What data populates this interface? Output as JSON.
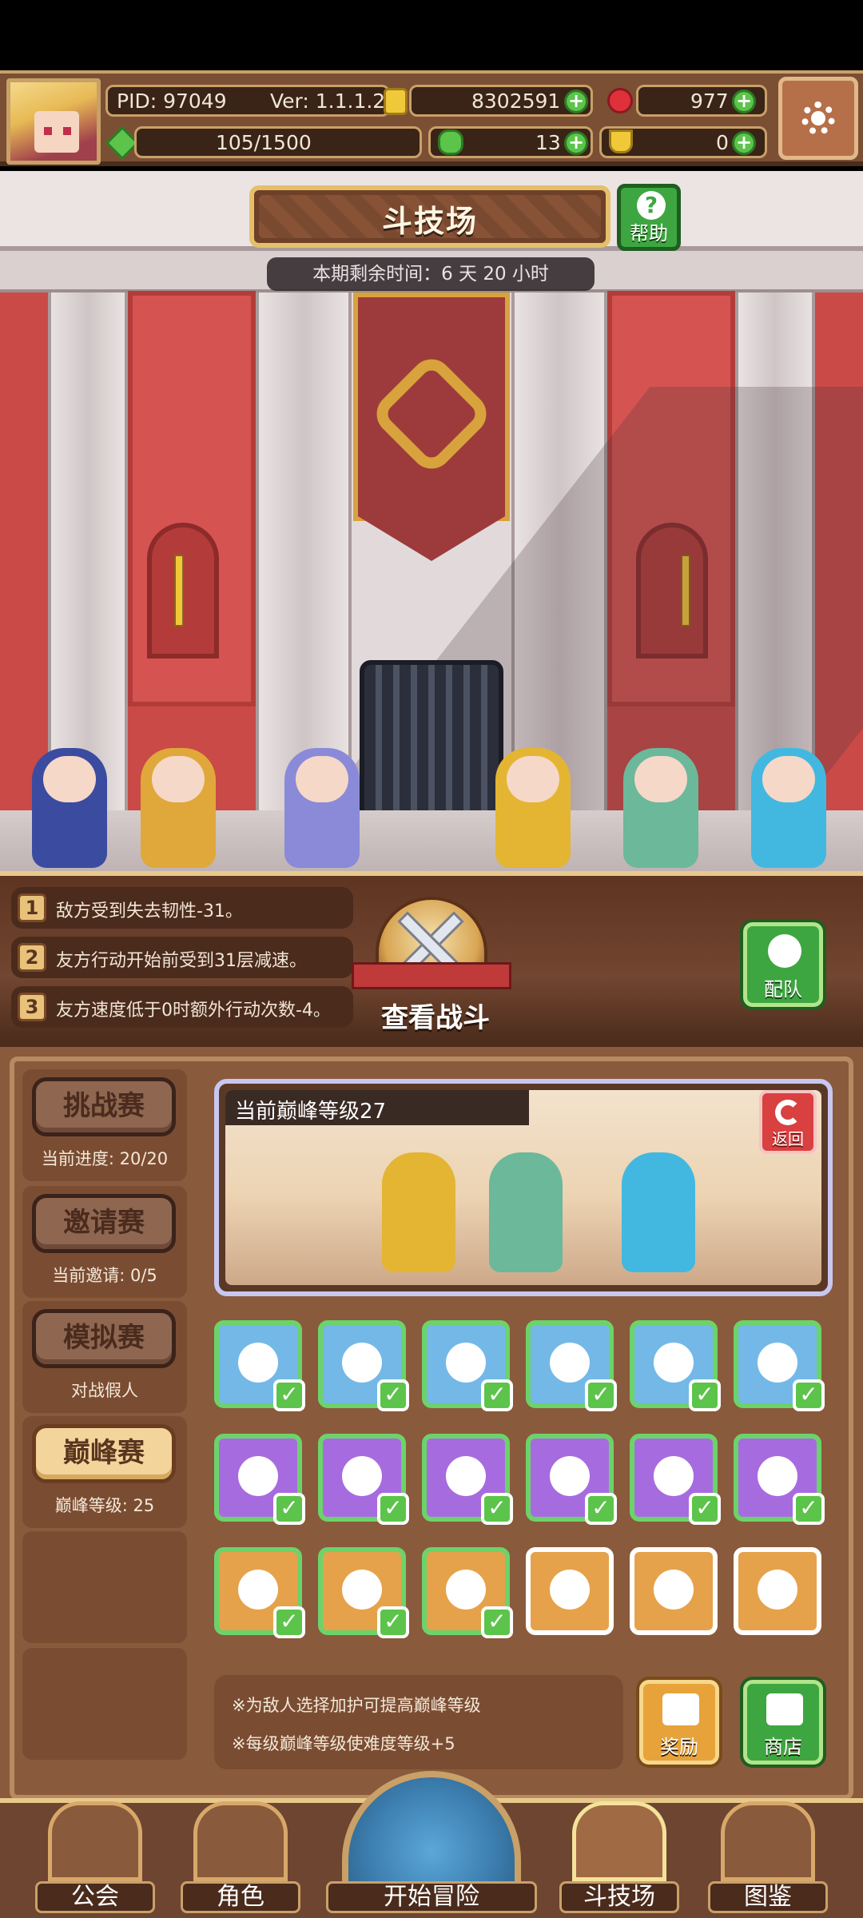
{
  "hud": {
    "pid": "PID: 97049",
    "version": "Ver: 1.1.1.2",
    "gold": "8302591",
    "gems": "977",
    "energy": "105/1500",
    "clovers": "13",
    "trophies": "0"
  },
  "arena": {
    "title": "斗技场",
    "help_label": "帮助",
    "remaining_time": "本期剩余时间：6 天 20 小时"
  },
  "rules": [
    {
      "num": "1",
      "text": "敌方受到失去韧性-31。"
    },
    {
      "num": "2",
      "text": "友方行动开始前受到31层减速。"
    },
    {
      "num": "3",
      "text": "友方速度低于0时额外行动次数-4。"
    }
  ],
  "battle": {
    "view_label": "查看战斗",
    "team_label": "配队"
  },
  "modes": [
    {
      "label": "挑战赛",
      "sub": "当前进度: 20/20",
      "active": false
    },
    {
      "label": "邀请赛",
      "sub": "当前邀请: 0/5",
      "active": false
    },
    {
      "label": "模拟赛",
      "sub": "对战假人",
      "active": false
    },
    {
      "label": "巅峰赛",
      "sub": "巅峰等级: 25",
      "active": true
    }
  ],
  "preview": {
    "header": "当前巅峰等级27",
    "back_label": "返回"
  },
  "buffs": [
    {
      "color": "blue",
      "icon": "snowflake-icon",
      "checked": true
    },
    {
      "color": "blue",
      "icon": "flame-icon",
      "checked": true
    },
    {
      "color": "blue",
      "icon": "tornado-icon",
      "checked": true
    },
    {
      "color": "blue",
      "icon": "sparkle-icon",
      "checked": true
    },
    {
      "color": "blue",
      "icon": "paw-icon",
      "checked": true
    },
    {
      "color": "blue",
      "icon": "claw-icon",
      "checked": true
    },
    {
      "color": "purple",
      "icon": "tree-icon",
      "checked": true
    },
    {
      "color": "purple",
      "icon": "shield-icon",
      "checked": true
    },
    {
      "color": "purple",
      "icon": "burst-icon",
      "checked": true
    },
    {
      "color": "purple",
      "icon": "lightning-icon",
      "checked": true
    },
    {
      "color": "purple",
      "icon": "gear-icon",
      "checked": true
    },
    {
      "color": "purple",
      "icon": "skull-icon",
      "checked": true
    },
    {
      "color": "orange",
      "icon": "fist-icon",
      "checked": true
    },
    {
      "color": "orange",
      "icon": "sleep-icon",
      "checked": true
    },
    {
      "color": "orange",
      "icon": "spiral-icon",
      "checked": true
    },
    {
      "color": "orange",
      "icon": "ghost-icon",
      "checked": false
    },
    {
      "color": "orange",
      "icon": "pickaxe-icon",
      "checked": false
    },
    {
      "color": "orange",
      "icon": "infinity-icon",
      "checked": false
    }
  ],
  "hints": [
    "※为敌人选择加护可提高巅峰等级",
    "※每级巅峰等级使难度等级+5"
  ],
  "actions": {
    "reward_label": "奖励",
    "shop_label": "商店"
  },
  "nav": {
    "guild": "公会",
    "character": "角色",
    "adventure": "开始冒险",
    "arena": "斗技场",
    "codex": "图鉴"
  },
  "colors": {
    "accent_green": "#5cc44a",
    "panel_brown": "#8a5a3c",
    "gold_border": "#c9a068"
  }
}
